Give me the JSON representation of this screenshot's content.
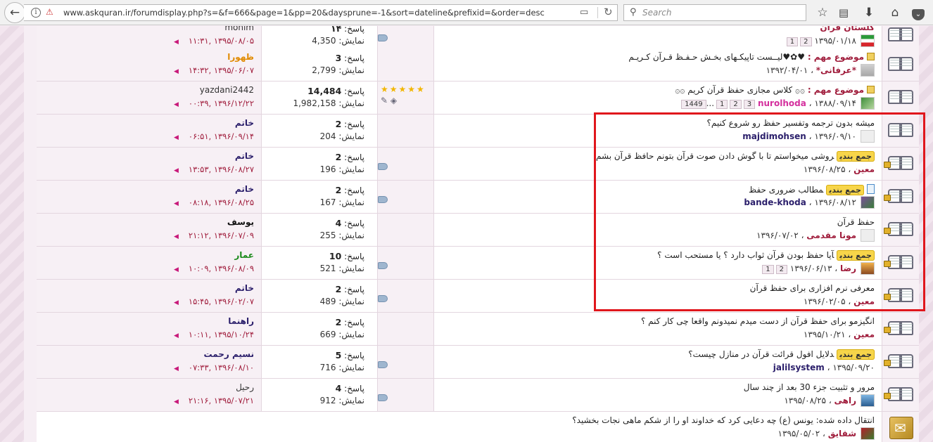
{
  "browser": {
    "url": "www.askquran.ir/forumdisplay.php?s=&f=666&page=1&pp=20&daysprune=-1&sort=dateline&prefixid=&order=desc",
    "search_placeholder": "Search",
    "info_glyph": "i",
    "lock_glyph": "⚠"
  },
  "labels": {
    "replies": "پاسخ:",
    "views": "نمایش:",
    "prefix_important": "موضوع مهم :",
    "prefix_summary": "جمع بندی",
    "sep": "،",
    "more": "..."
  },
  "threads": [
    {
      "title": "گلستان قرآن",
      "title_style": "author-red",
      "date": "۱۳۹۵/۰۱/۱۸",
      "pages": [
        "2",
        "1"
      ],
      "replies": "۱۴",
      "views": "4,350",
      "last_user": "monim",
      "last_date": "۱۳۹۵/۰۸/۰۵ ,",
      "last_time": "۱۱:۳۱",
      "avatar": "flag"
    },
    {
      "prefix": "موضوع مهم :",
      "title": "♥✿♥لیــست تاپیکـهای بخـش حـفـظ قـرآن کـریـم",
      "author": "*عرفانی*",
      "date": "۱۳۹۲/۰۴/۰۱",
      "replies": "3",
      "views": "2,799",
      "last_user": "ظهورا",
      "last_date": "۱۳۹۵/۰۶/۰۷ ,",
      "last_time": "۱۴:۳۲",
      "avatar": "gray"
    },
    {
      "prefix": "موضوع مهم :",
      "title": "۞۞ کلاس مجازی حفظ قرآن کریم ۞۞",
      "author": "nurolhoda",
      "date": "۱۳۸۸/۰۹/۱۴",
      "pages": [
        "3",
        "2",
        "1",
        "1449"
      ],
      "replies": "14,484",
      "views": "1,982,158",
      "last_user": "yazdani2442",
      "last_date": "۱۳۹۶/۱۲/۲۲ ,",
      "last_time": "۰۰:۳۹",
      "rating_stars": "★★★★★",
      "avatar": "grn"
    },
    {
      "title": "میشه بدون ترجمه وتفسیر حفظ رو شروع کنیم؟",
      "author": "majdimohsen",
      "date": "۱۳۹۶/۰۹/۱۰",
      "replies": "2",
      "views": "204",
      "last_user": "خاتم",
      "last_date": "۱۳۹۶/۰۹/۱۴ ,",
      "last_time": "۰۶:۵۱",
      "avatar": "blank"
    },
    {
      "summary": true,
      "title": "روشی میخواستم تا با گوش دادن صوت قرآن بتونم حافظ قرآن بشم",
      "author": "معین",
      "date": "۱۳۹۶/۰۸/۲۵",
      "replies": "2",
      "views": "196",
      "last_user": "خاتم",
      "last_date": "۱۳۹۶/۰۸/۲۷ ,",
      "last_time": "۱۳:۵۳",
      "locked": true
    },
    {
      "summary": true,
      "title": "مطالب ضروری حفظ",
      "author": "bande-khoda",
      "date": "۱۳۹۶/۰۸/۱۲",
      "replies": "2",
      "views": "167",
      "last_user": "خاتم",
      "last_date": "۱۳۹۶/۰۸/۲۵ ,",
      "last_time": "۰۸:۱۸",
      "locked": true,
      "avatar": "flower"
    },
    {
      "title": "حفظ قرآن",
      "author": "مونا مقدمی",
      "date": "۱۳۹۶/۰۷/۰۲",
      "replies": "4",
      "views": "255",
      "last_user": "یوسف",
      "last_date": "۱۳۹۶/۰۷/۰۹ ,",
      "last_time": "۲۱:۱۲",
      "locked": true,
      "avatar": "blank"
    },
    {
      "summary": true,
      "title": "آیا حفظ بودن قرآن ثواب دارد ؟ یا مستحب است ؟",
      "author": "رضا",
      "date": "۱۳۹۶/۰۶/۱۳",
      "pages": [
        "2",
        "1"
      ],
      "replies": "10",
      "views": "521",
      "last_user": "عمار",
      "last_date": "۱۳۹۶/۰۸/۰۹ ,",
      "last_time": "۱۰:۰۹",
      "locked": true,
      "avatar": "sunset"
    },
    {
      "title": "معرفی نرم افزاری برای حفظ قرآن",
      "author": "معین",
      "date": "۱۳۹۶/۰۲/۰۵",
      "replies": "2",
      "views": "489",
      "last_user": "خاتم",
      "last_date": "۱۳۹۶/۰۲/۰۷ ,",
      "last_time": "۱۵:۴۵",
      "locked": true
    },
    {
      "title": "انگیزمو برای حفظ قرآن از دست میدم نمیدونم واقعا چی کار کنم ؟",
      "author": "معین",
      "date": "۱۳۹۵/۱۰/۲۱",
      "replies": "2",
      "views": "669",
      "last_user": "راهنما",
      "last_date": "۱۳۹۵/۱۰/۲۴ ,",
      "last_time": "۱۰:۱۱",
      "locked": true
    },
    {
      "summary": true,
      "title": "دلایل افول قرائت قرآن در منازل چیست؟",
      "author": "jalilsystem",
      "date": "۱۳۹۵/۰۹/۲۰",
      "replies": "5",
      "views": "716",
      "last_user": "نسیم رحمت",
      "last_date": "۱۳۹۶/۰۸/۱۰ ,",
      "last_time": "۰۷:۳۳",
      "locked": true
    },
    {
      "title": "مرور و تثبیت جزء 30 بعد از چند سال",
      "author": "راهی",
      "date": "۱۳۹۵/۰۸/۲۵",
      "replies": "4",
      "views": "912",
      "last_user": "رحیل",
      "last_date": "۱۳۹۵/۰۷/۲۱ ,",
      "last_time": "۲۱:۱۶",
      "locked": true,
      "avatar": "sea"
    },
    {
      "title": "انتقال داده شده: یونس (ع) چه دعایی کرد که خداوند او را از شکم ماهی نجات بخشید؟",
      "author": "شقایق",
      "date": "۱۳۹۵/۰۵/۰۲",
      "avatar": "rose",
      "moved": true
    }
  ]
}
